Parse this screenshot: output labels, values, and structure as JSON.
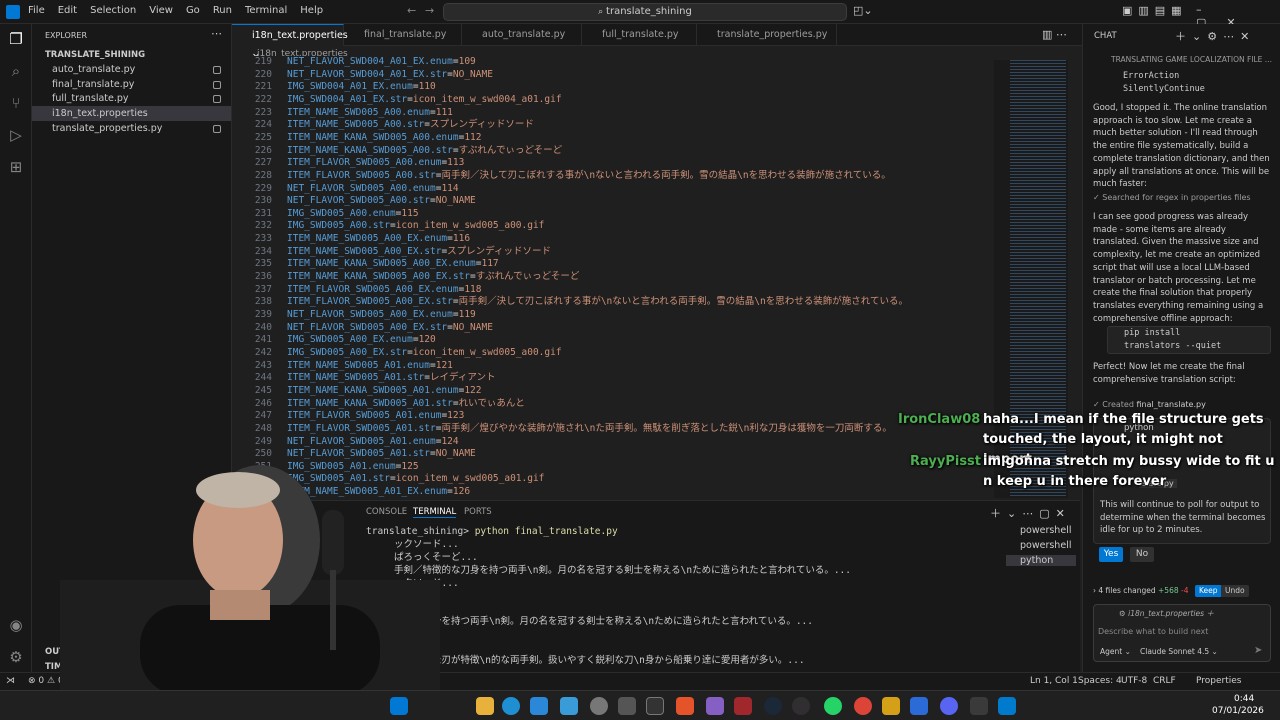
{
  "menu": [
    "File",
    "Edit",
    "Selection",
    "View",
    "Go",
    "Run",
    "Terminal",
    "Help"
  ],
  "search": {
    "text": "translate_shining"
  },
  "explorer": {
    "title": "EXPLORER",
    "root": "TRANSLATE_SHINING",
    "files": [
      {
        "name": "auto_translate.py"
      },
      {
        "name": "final_translate.py"
      },
      {
        "name": "full_translate.py"
      },
      {
        "name": "i18n_text.properties"
      },
      {
        "name": "translate_properties.py"
      }
    ],
    "outline": "OUTLINE",
    "timeline": "TIMELINE"
  },
  "tabs": [
    {
      "label": "i18n_text.properties"
    },
    {
      "label": "final_translate.py"
    },
    {
      "label": "auto_translate.py"
    },
    {
      "label": "full_translate.py"
    },
    {
      "label": "translate_properties.py"
    }
  ],
  "breadcrumb": "i18n_text.properties",
  "editor_lines": [
    {
      "n": "219",
      "key": "NET_FLAVOR_SWD004_A01_EX.enum",
      "val": "109"
    },
    {
      "n": "220",
      "key": "NET_FLAVOR_SWD004_A01_EX.str",
      "val": "NO_NAME"
    },
    {
      "n": "221",
      "key": "IMG_SWD004_A01_EX.enum",
      "val": "110"
    },
    {
      "n": "222",
      "key": "IMG_SWD004_A01_EX.str",
      "val": "icon_item_w_swd004_a01.gif"
    },
    {
      "n": "223",
      "key": "ITEM_NAME_SWD005_A00.enum",
      "val": "111"
    },
    {
      "n": "224",
      "key": "ITEM_NAME_SWD005_A00.str",
      "val": "スプレンディッドソード"
    },
    {
      "n": "225",
      "key": "ITEM_NAME_KANA_SWD005_A00.enum",
      "val": "112"
    },
    {
      "n": "226",
      "key": "ITEM_NAME_KANA_SWD005_A00.str",
      "val": "すぷれんでぃっどそーど"
    },
    {
      "n": "227",
      "key": "ITEM_FLAVOR_SWD005_A00.enum",
      "val": "113"
    },
    {
      "n": "228",
      "key": "ITEM_FLAVOR_SWD005_A00.str",
      "val": "両手剣／決して刃こぼれする事が\\nないと言われる両手剣。雪の結晶\\nを思わせる装飾が施されている。"
    },
    {
      "n": "229",
      "key": "NET_FLAVOR_SWD005_A00.enum",
      "val": "114"
    },
    {
      "n": "230",
      "key": "NET_FLAVOR_SWD005_A00.str",
      "val": "NO_NAME"
    },
    {
      "n": "231",
      "key": "IMG_SWD005_A00.enum",
      "val": "115"
    },
    {
      "n": "232",
      "key": "IMG_SWD005_A00.str",
      "val": "icon_item_w_swd005_a00.gif"
    },
    {
      "n": "233",
      "key": "ITEM_NAME_SWD005_A00_EX.enum",
      "val": "116"
    },
    {
      "n": "234",
      "key": "ITEM_NAME_SWD005_A00_EX.str",
      "val": "スプレンディッドソード"
    },
    {
      "n": "235",
      "key": "ITEM_NAME_KANA_SWD005_A00_EX.enum",
      "val": "117"
    },
    {
      "n": "236",
      "key": "ITEM_NAME_KANA_SWD005_A00_EX.str",
      "val": "すぷれんでぃっどそーど"
    },
    {
      "n": "237",
      "key": "ITEM_FLAVOR_SWD005_A00_EX.enum",
      "val": "118"
    },
    {
      "n": "238",
      "key": "ITEM_FLAVOR_SWD005_A00_EX.str",
      "val": "両手剣／決して刃こぼれする事が\\nないと言われる両手剣。雪の結晶\\nを思わせる装飾が施されている。"
    },
    {
      "n": "239",
      "key": "NET_FLAVOR_SWD005_A00_EX.enum",
      "val": "119"
    },
    {
      "n": "240",
      "key": "NET_FLAVOR_SWD005_A00_EX.str",
      "val": "NO_NAME"
    },
    {
      "n": "241",
      "key": "IMG_SWD005_A00_EX.enum",
      "val": "120"
    },
    {
      "n": "242",
      "key": "IMG_SWD005_A00_EX.str",
      "val": "icon_item_w_swd005_a00.gif"
    },
    {
      "n": "243",
      "key": "ITEM_NAME_SWD005_A01.enum",
      "val": "121"
    },
    {
      "n": "244",
      "key": "ITEM_NAME_SWD005_A01.str",
      "val": "レイディアント"
    },
    {
      "n": "245",
      "key": "ITEM_NAME_KANA_SWD005_A01.enum",
      "val": "122"
    },
    {
      "n": "246",
      "key": "ITEM_NAME_KANA_SWD005_A01.str",
      "val": "れいでぃあんと"
    },
    {
      "n": "247",
      "key": "ITEM_FLAVOR_SWD005_A01.enum",
      "val": "123"
    },
    {
      "n": "248",
      "key": "ITEM_FLAVOR_SWD005_A01.str",
      "val": "両手剣／煌びやかな装飾が施され\\nた両手剣。無駄を削ぎ落とした鋭\\n利な刀身は獲物を一刀両断する。"
    },
    {
      "n": "249",
      "key": "NET_FLAVOR_SWD005_A01.enum",
      "val": "124"
    },
    {
      "n": "250",
      "key": "NET_FLAVOR_SWD005_A01.str",
      "val": "NO_NAME"
    },
    {
      "n": "251",
      "key": "IMG_SWD005_A01.enum",
      "val": "125"
    },
    {
      "n": "252",
      "key": "IMG_SWD005_A01.str",
      "val": "icon_item_w_swd005_a01.gif"
    },
    {
      "n": "253",
      "key": "ITEM_NAME_SWD005_A01_EX.enum",
      "val": "126"
    }
  ],
  "panel": {
    "tabs": [
      "CONSOLE",
      "TERMINAL",
      "PORTS"
    ],
    "prompt": "translate_shining>",
    "command": "python final_translate.py",
    "lines": [
      "ックソード...",
      "ぱろっくそーど...",
      "手剣／特徴的な刀身を持つ両手\\n剣。月の名を冠する剣士を称える\\nために造られたと言われている。...",
      "ックソード...",
      "そーど...",
      "",
      "徴的な刀身を持つ両手\\n剣。月の名を冠する剣士を称える\\nために造られたと言われている。...",
      "...",
      "...",
      "く湾曲した刃が特徴\\n的な両手剣。扱いやすく鋭利な刀\\n身から船乗り達に愛用者が多い。..."
    ],
    "shells": [
      "powershell",
      "powershell",
      "python"
    ]
  },
  "chat": {
    "header": "CHAT",
    "session": "TRANSLATING GAME LOCALIZATION FILE ...",
    "code_top": [
      "ErrorAction",
      "SilentlyContinue"
    ],
    "msg1": "Good, I stopped it. The online translation approach is too slow. Let me create a much better solution - I'll read through the entire file systematically, build a complete translation dictionary, and then apply all translations at once. This will be much faster:",
    "tool1": "Searched for regex in properties files",
    "msg2": "I can see good progress was already made - some items are already translated. Given the massive size and complexity, let me create an optimized script that will use a local LLM-based translator or batch processing. Let me create the final solution that properly translates everything remaining using a comprehensive offline approach:",
    "cmd": [
      "pip install",
      "translators --quiet"
    ],
    "msg3": "Perfect! Now let me create the final comprehensive translation script:",
    "created": "Created",
    "created_file": "final_translate.py",
    "term_label": "python",
    "term_file": "slate.py",
    "msg4": "This will continue to poll for output to determine when the terminal becomes idle for up to 2 minutes.",
    "yes": "Yes",
    "no": "No",
    "changes": "4 files changed",
    "added": "+568",
    "removed": "-4",
    "keep": "Keep",
    "undo": "Undo",
    "context_file": "i18n_text.properties",
    "input_placeholder": "Describe what to build next",
    "agent": "Agent",
    "model": "Claude Sonnet 4.5"
  },
  "overlay": {
    "messages": [
      {
        "user": "IronClaw08",
        "text": "haha...I mean if the file structure gets touched, the layout, it might not import"
      },
      {
        "user": "RayyPisst",
        "text": "im gonna stretch my bussy wide to fit u n keep u in there forever"
      }
    ]
  },
  "status": {
    "errors": "0",
    "warnings": "0",
    "position": "Ln 1, Col 1",
    "spaces": "Spaces: 4",
    "encoding": "UTF-8",
    "eol": "CRLF",
    "language": "Properties"
  },
  "taskbar": {
    "time": "0:44",
    "date": "07/01/2026"
  }
}
